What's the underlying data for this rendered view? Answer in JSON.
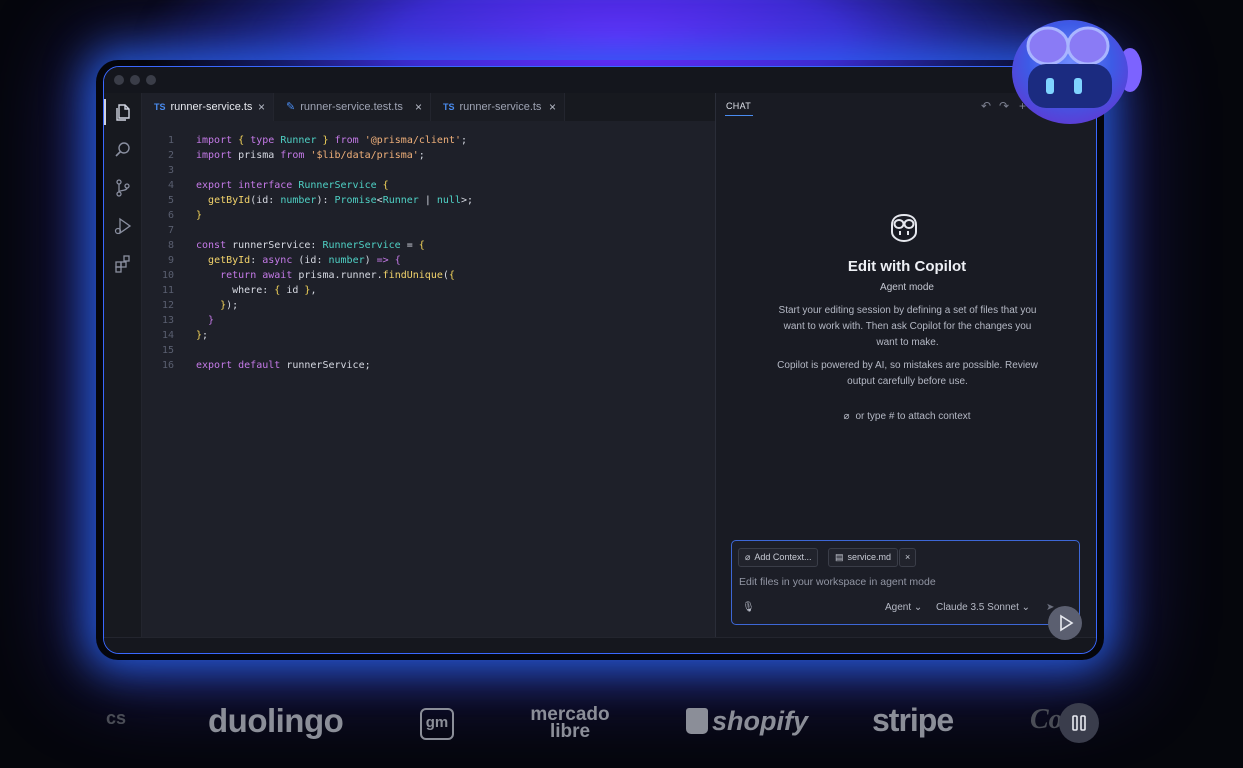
{
  "editor": {
    "tabs": [
      {
        "badge": "TS",
        "label": "runner-service.ts",
        "close": "×"
      },
      {
        "badge": "",
        "label": "runner-service.test.ts",
        "close": "×"
      },
      {
        "badge": "TS",
        "label": "runner-service.ts",
        "close": "×"
      }
    ],
    "line_numbers": [
      "1",
      "2",
      "3",
      "4",
      "5",
      "6",
      "7",
      "8",
      "9",
      "10",
      "11",
      "12",
      "13",
      "14",
      "15",
      "16"
    ]
  },
  "chat": {
    "tab_label": "CHAT",
    "title": "Edit with Copilot",
    "mode": "Agent mode",
    "paragraph1": "Start your editing session by defining a set of files that you want to work with. Then ask Copilot for the changes you want to make.",
    "paragraph2": "Copilot is powered by AI, so mistakes are possible. Review output carefully before use.",
    "attach_hint": "or type # to attach context",
    "input": {
      "add_context": "Add Context...",
      "file_pill": "service.md",
      "placeholder": "Edit files in your workspace in agent mode",
      "agent_select": "Agent",
      "model_select": "Claude 3.5 Sonnet"
    }
  },
  "logos": {
    "partial_left": "cs",
    "duolingo": "duolingo",
    "gm": "gm",
    "mercado_line1": "mercado",
    "mercado_line2": "libre",
    "shopify": "shopify",
    "stripe": "stripe",
    "partial_right": "Co"
  },
  "colors": {
    "accent": "#3a68ff",
    "keyword": "#c57ae8",
    "type": "#4fd1c5",
    "function": "#f2d36b",
    "string": "#f0b07a"
  }
}
